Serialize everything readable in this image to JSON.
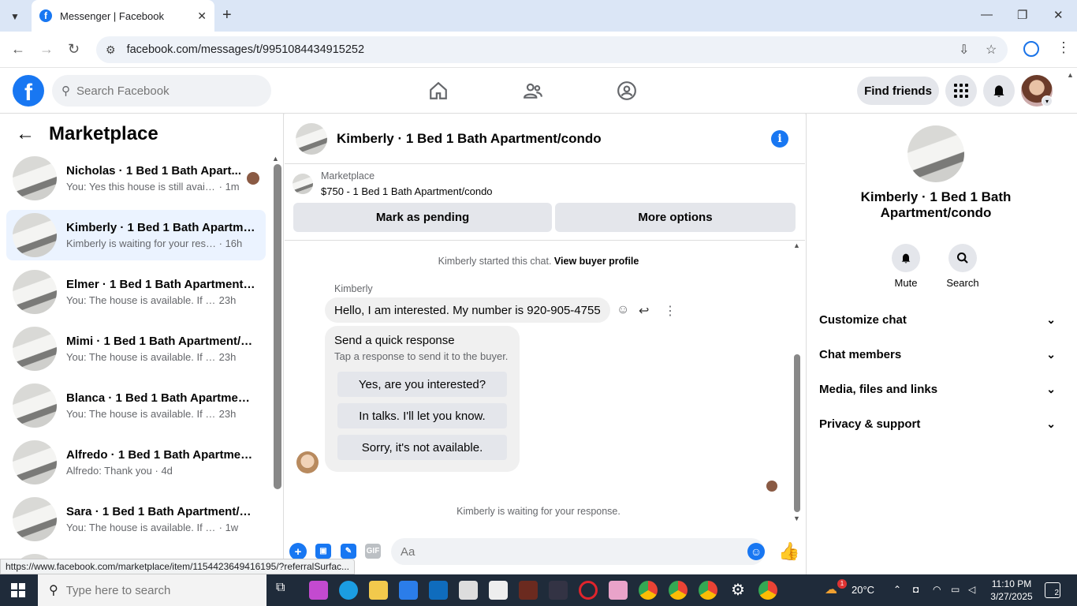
{
  "browser": {
    "tab_title": "Messenger | Facebook",
    "url": "facebook.com/messages/t/9951084434915252",
    "status_url": "https://www.facebook.com/marketplace/item/1154423649416195/?referralSurfac..."
  },
  "fb_header": {
    "search_placeholder": "Search Facebook",
    "find_friends": "Find friends",
    "brand_color": "#1877f2"
  },
  "sidebar": {
    "title": "Marketplace",
    "conversations": [
      {
        "name": "Nicholas · 1 Bed 1 Bath Apart...",
        "preview": "You: Yes this house is still availa...",
        "time": "· 1m"
      },
      {
        "name": "Kimberly · 1 Bed 1 Bath Apartme...",
        "preview": "Kimberly is waiting for your respo...",
        "time": "· 16h"
      },
      {
        "name": "Elmer · 1 Bed 1 Bath Apartment/...",
        "preview": "You: The house is available. If you ...",
        "time": "23h"
      },
      {
        "name": "Mimi · 1 Bed 1 Bath Apartment/c...",
        "preview": "You: The house is available. If you ...",
        "time": "23h"
      },
      {
        "name": "Blanca · 1 Bed 1 Bath Apartment...",
        "preview": "You: The house is available. If you ...",
        "time": "23h"
      },
      {
        "name": "Alfredo · 1 Bed 1 Bath Apartmen...",
        "preview": "Alfredo: Thank you",
        "time": "· 4d"
      },
      {
        "name": "Sara · 1 Bed 1 Bath Apartment/c...",
        "preview": "You: The house is available. If you a...",
        "time": "· 1w"
      }
    ]
  },
  "chat": {
    "title": "Kimberly · 1 Bed 1 Bath Apartment/condo",
    "listing_source": "Marketplace",
    "listing": "$750 - 1 Bed 1 Bath Apartment/condo",
    "mark_pending": "Mark as pending",
    "more_options": "More options",
    "started_text": "Kimberly started this chat.",
    "view_profile": "View buyer profile",
    "sender": "Kimberly",
    "message": "Hello, I am interested. My number is 920-905-4755",
    "quick_title": "Send a quick response",
    "quick_sub": "Tap a response to send it to the buyer.",
    "quick_replies": [
      "Yes, are you interested?",
      "In talks. I'll let you know.",
      "Sorry, it's not available."
    ],
    "waiting_text": "Kimberly is waiting for your response.",
    "composer_placeholder": "Aa",
    "gif_label": "GIF"
  },
  "details": {
    "name": "Kimberly · 1 Bed 1 Bath Apartment/condo",
    "mute": "Mute",
    "search": "Search",
    "sections": [
      "Customize chat",
      "Chat members",
      "Media, files and links",
      "Privacy & support"
    ]
  },
  "taskbar": {
    "search_placeholder": "Type here to search",
    "weather": "20°C",
    "time": "11:10 PM",
    "date": "3/27/2025",
    "notif_count": "2",
    "weather_badge": "1"
  }
}
